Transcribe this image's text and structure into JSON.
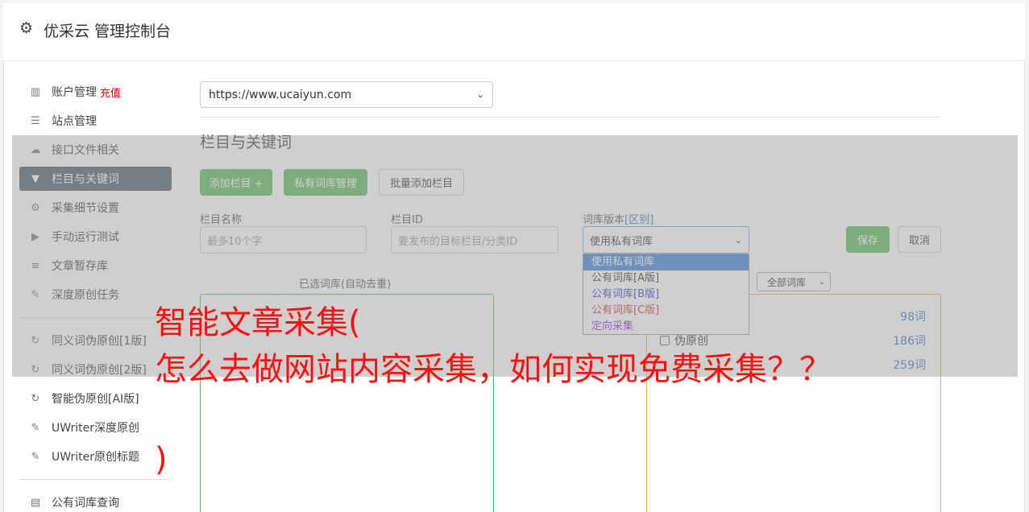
{
  "header": {
    "title": "优采云 管理控制台",
    "icon": "gear-icon"
  },
  "sidebar": {
    "items": [
      {
        "label": "账户管理",
        "badge": "充值",
        "icon": "bar-chart-icon"
      },
      {
        "label": "站点管理",
        "icon": "server-icon"
      },
      {
        "label": "接口文件相关",
        "icon": "cloud-upload-icon"
      },
      {
        "label": "栏目与关键词",
        "icon": "filter-icon",
        "active": true
      },
      {
        "label": "采集细节设置",
        "icon": "cogs-icon"
      },
      {
        "label": "手动运行测试",
        "icon": "play-circle-icon"
      },
      {
        "label": "文章暂存库",
        "icon": "database-icon"
      },
      {
        "label": "深度原创任务",
        "icon": "edit-icon"
      },
      {
        "label": "同义词伪原创[1版]",
        "icon": "refresh-icon"
      },
      {
        "label": "同义词伪原创[2版]",
        "icon": "refresh-icon"
      },
      {
        "label": "智能伪原创[AI版]",
        "icon": "refresh-icon"
      },
      {
        "label": "UWriter深度原创",
        "icon": "edit-icon"
      },
      {
        "label": "UWriter原创标题",
        "icon": "edit-icon"
      },
      {
        "label": "公有词库查询",
        "icon": "book-icon"
      }
    ]
  },
  "main": {
    "site_select": "https://www.ucaiyun.com",
    "section_title": "栏目与关键词",
    "buttons": {
      "add_column": "添加栏目 +",
      "private_lib": "私有词库管理",
      "batch_add": "批量添加栏目",
      "save": "保存",
      "cancel": "取消"
    },
    "form": {
      "name_label": "栏目名称",
      "name_placeholder": "最多10个字",
      "id_label": "栏目ID",
      "id_placeholder": "要发布的目标栏目/分类ID",
      "lib_label": "词库版本",
      "lib_diff": "[区别]",
      "lib_value": "使用私有词库"
    },
    "dropdown_options": [
      {
        "label": "使用私有词库",
        "color": "#ffffff"
      },
      {
        "label": "公有词库[A版]",
        "color": "#333333"
      },
      {
        "label": "公有词库[B版]",
        "color": "#3333cc"
      },
      {
        "label": "公有词库[C版]",
        "color": "#cc3333"
      },
      {
        "label": "定向采集",
        "color": "#8a2be2"
      }
    ],
    "selected_box_label": "已选词库(自动去重)",
    "lib_filter": "全部词库",
    "lib_rows": [
      {
        "label": "",
        "count": "98词"
      },
      {
        "label": "伪原创",
        "count": "186词"
      },
      {
        "label": "",
        "count": "259词"
      }
    ]
  },
  "overlay_text": {
    "line1": "智能文章采集(",
    "line2": "怎么去做网站内容采集，如何实现免费采集？？",
    "line3": ")"
  }
}
